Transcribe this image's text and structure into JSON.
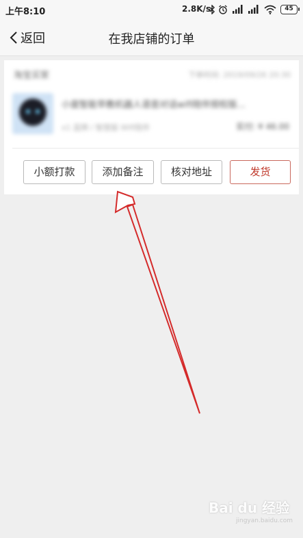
{
  "status_bar": {
    "time": "上午8:10",
    "network_speed": "2.8K/s",
    "battery_level": "45",
    "icons": [
      "bluetooth-icon",
      "alarm-icon",
      "signal-icon",
      "signal-icon",
      "wifi-icon",
      "battery-icon"
    ]
  },
  "nav": {
    "back_label": "返回",
    "title": "在我店铺的订单"
  },
  "order": {
    "buyer": "淘宝买家",
    "time": "下单时间: 2019/09/26 20:30",
    "product_title": "小度智能早教机器人语音对话wifi陪伴授权版...",
    "product_spec": "x1 蓝牌 / 智慧版 Wifi陪伴",
    "product_price": "实付: ¥ 46.00",
    "actions": [
      {
        "label": "小额打款"
      },
      {
        "label": "添加备注"
      },
      {
        "label": "核对地址"
      },
      {
        "label": "发货"
      }
    ]
  },
  "annotation": {
    "color": "#d42a2a"
  },
  "watermark": {
    "text": "Bai du 经验",
    "sub": "jingyan.baidu.com"
  },
  "colors": {
    "accent": "#c0392b",
    "background": "#efefef"
  }
}
